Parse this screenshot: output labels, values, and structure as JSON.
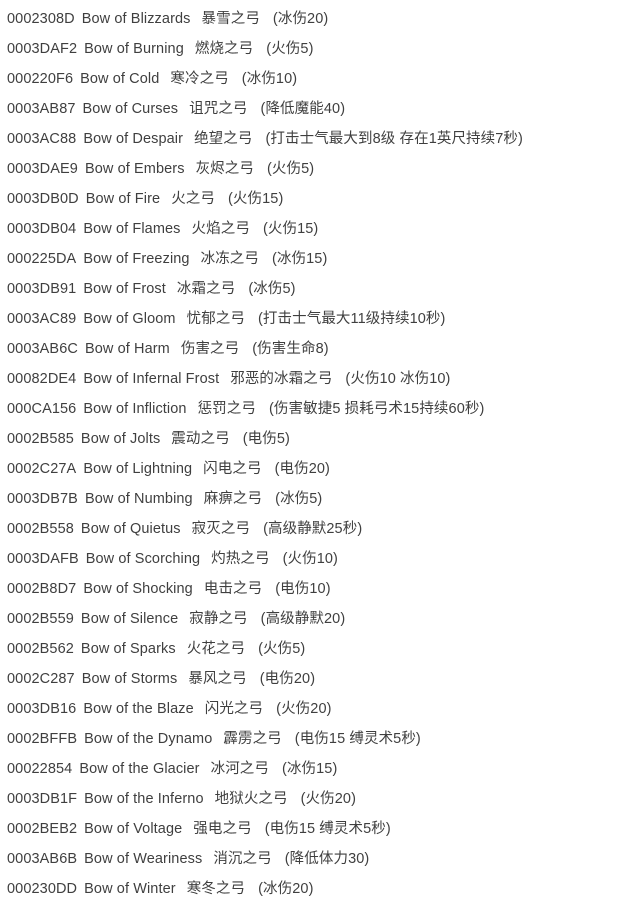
{
  "page": {
    "title": "Bow of ... item ID reference list",
    "background_color": "#ffffff",
    "text_color": "#3f3f3f"
  },
  "list": {
    "name": "bow-item-id-list",
    "rows": [
      {
        "id": "0002308D",
        "name_en": "Bow of Blizzards",
        "name_zh": "暴雪之弓",
        "effect": "(冰伤20)"
      },
      {
        "id": "0003DAF2",
        "name_en": "Bow of Burning",
        "name_zh": "燃烧之弓",
        "effect": "(火伤5)"
      },
      {
        "id": "000220F6",
        "name_en": "Bow of Cold",
        "name_zh": "寒冷之弓",
        "effect": "(冰伤10)"
      },
      {
        "id": "0003AB87",
        "name_en": "Bow of Curses",
        "name_zh": "诅咒之弓",
        "effect": "(降低魔能40)"
      },
      {
        "id": "0003AC88",
        "name_en": "Bow of Despair",
        "name_zh": "绝望之弓",
        "effect": "(打击士气最大到8级 存在1英尺持续7秒)"
      },
      {
        "id": "0003DAE9",
        "name_en": "Bow of Embers",
        "name_zh": "灰烬之弓",
        "effect": "(火伤5)"
      },
      {
        "id": "0003DB0D",
        "name_en": "Bow of Fire",
        "name_zh": "火之弓",
        "effect": "(火伤15)"
      },
      {
        "id": "0003DB04",
        "name_en": "Bow of Flames",
        "name_zh": "火焰之弓",
        "effect": "(火伤15)"
      },
      {
        "id": "000225DA",
        "name_en": "Bow of Freezing",
        "name_zh": "冰冻之弓",
        "effect": "(冰伤15)"
      },
      {
        "id": "0003DB91",
        "name_en": "Bow of Frost",
        "name_zh": "冰霜之弓",
        "effect": "(冰伤5)"
      },
      {
        "id": "0003AC89",
        "name_en": "Bow of Gloom",
        "name_zh": "忧郁之弓",
        "effect": "(打击士气最大11级持续10秒)"
      },
      {
        "id": "0003AB6C",
        "name_en": "Bow of Harm",
        "name_zh": "伤害之弓",
        "effect": "(伤害生命8)"
      },
      {
        "id": "00082DE4",
        "name_en": "Bow of Infernal Frost",
        "name_zh": "邪恶的冰霜之弓",
        "effect": "(火伤10  冰伤10)"
      },
      {
        "id": "000CA156",
        "name_en": "Bow of Infliction",
        "name_zh": "惩罚之弓",
        "effect": "(伤害敏捷5 损耗弓术15持续60秒)"
      },
      {
        "id": "0002B585",
        "name_en": "Bow of Jolts",
        "name_zh": "震动之弓",
        "effect": "(电伤5)"
      },
      {
        "id": "0002C27A",
        "name_en": "Bow of Lightning",
        "name_zh": "闪电之弓",
        "effect": "(电伤20)"
      },
      {
        "id": "0003DB7B",
        "name_en": "Bow of Numbing",
        "name_zh": "麻痹之弓",
        "effect": "(冰伤5)"
      },
      {
        "id": "0002B558",
        "name_en": "Bow of Quietus",
        "name_zh": "寂灭之弓",
        "effect": "(高级静默25秒)"
      },
      {
        "id": "0003DAFB",
        "name_en": "Bow of Scorching",
        "name_zh": "灼热之弓",
        "effect": "(火伤10)"
      },
      {
        "id": "0002B8D7",
        "name_en": "Bow of Shocking",
        "name_zh": "电击之弓",
        "effect": "(电伤10)"
      },
      {
        "id": "0002B559",
        "name_en": "Bow of Silence",
        "name_zh": "寂静之弓",
        "effect": "(高级静默20)"
      },
      {
        "id": "0002B562",
        "name_en": "Bow of Sparks",
        "name_zh": "火花之弓",
        "effect": "(火伤5)"
      },
      {
        "id": "0002C287",
        "name_en": "Bow of Storms",
        "name_zh": "暴风之弓",
        "effect": "(电伤20)"
      },
      {
        "id": "0003DB16",
        "name_en": "Bow of the Blaze",
        "name_zh": "闪光之弓",
        "effect": "(火伤20)"
      },
      {
        "id": "0002BFFB",
        "name_en": "Bow of the Dynamo",
        "name_zh": "霹雳之弓",
        "effect": "(电伤15  缚灵术5秒)"
      },
      {
        "id": "00022854",
        "name_en": "Bow of the Glacier",
        "name_zh": "冰河之弓",
        "effect": "(冰伤15)"
      },
      {
        "id": "0003DB1F",
        "name_en": "Bow of the Inferno",
        "name_zh": "地狱火之弓",
        "effect": "(火伤20)"
      },
      {
        "id": "0002BEB2",
        "name_en": "Bow of Voltage",
        "name_zh": "强电之弓",
        "effect": "(电伤15  缚灵术5秒)"
      },
      {
        "id": "0003AB6B",
        "name_en": "Bow of Weariness",
        "name_zh": "消沉之弓",
        "effect": "(降低体力30)"
      },
      {
        "id": "000230DD",
        "name_en": "Bow of Winter",
        "name_zh": "寒冬之弓",
        "effect": "(冰伤20)"
      }
    ]
  }
}
